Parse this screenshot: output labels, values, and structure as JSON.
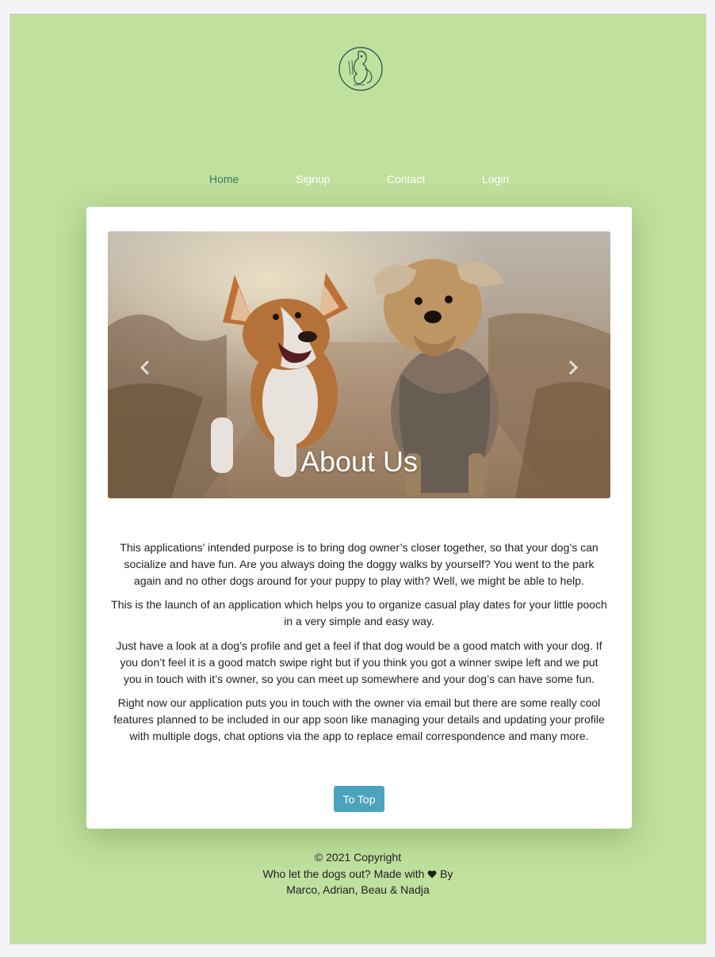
{
  "logo": {
    "icon": "dog-logo-icon",
    "alt_text": "Who let the dogs out"
  },
  "nav": {
    "items": [
      {
        "label": "Home",
        "active": true
      },
      {
        "label": "Signup",
        "active": false
      },
      {
        "label": "Contact",
        "active": false
      },
      {
        "label": "Login",
        "active": false
      }
    ]
  },
  "carousel": {
    "caption": "About Us",
    "prev_icon": "chevron-left-icon",
    "next_icon": "chevron-right-icon"
  },
  "about": {
    "paragraphs": [
      "This applications’ intended purpose is to bring dog owner’s closer together, so that your dog’s can socialize and have fun. Are you always doing the doggy walks by yourself? You went to the park again and no other dogs around for your puppy to play with? Well, we might be able to help.",
      "This is the launch of an application which helps you to organize casual play dates for your little pooch in a very simple and easy way.",
      "Just have a look at a dog’s profile and get a feel if that dog would be a good match with your dog. If you don’t feel it is a good match swipe right but if you think you got a winner swipe left and we put you in touch with it’s owner, so you can meet up somewhere and your dog’s can have some fun.",
      "Right now our application puts you in touch with the owner via email but there are some really cool features planned to be included in our app soon like managing your details and updating your profile with multiple dogs, chat options via the app to replace email correspondence and many more."
    ]
  },
  "to_top_label": "To Top",
  "footer": {
    "copyright": "© 2021 Copyright",
    "made_with_prefix": "Who let the dogs out? Made with",
    "made_with_suffix": "By",
    "heart_icon": "heart-icon",
    "authors": "Marco, Adrian, Beau & Nadja"
  },
  "colors": {
    "page_background": "#c0e09d",
    "nav_active": "#3d7a6c",
    "button": "#4ba3bd"
  }
}
